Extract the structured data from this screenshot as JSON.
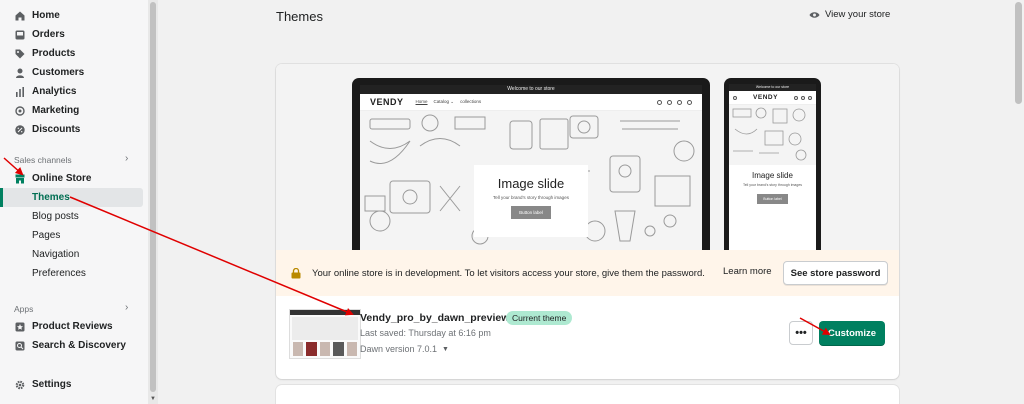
{
  "sidebar": {
    "items": [
      {
        "label": "Home",
        "icon": "home-icon"
      },
      {
        "label": "Orders",
        "icon": "orders-icon"
      },
      {
        "label": "Products",
        "icon": "tag-icon"
      },
      {
        "label": "Customers",
        "icon": "person-icon"
      },
      {
        "label": "Analytics",
        "icon": "bar-chart-icon"
      },
      {
        "label": "Marketing",
        "icon": "target-icon"
      },
      {
        "label": "Discounts",
        "icon": "discount-icon"
      }
    ],
    "sales_channels_label": "Sales channels",
    "online_store": {
      "label": "Online Store",
      "icon": "store-icon"
    },
    "online_store_subitems": [
      "Themes",
      "Blog posts",
      "Pages",
      "Navigation",
      "Preferences"
    ],
    "active_subitem": "Themes",
    "apps_label": "Apps",
    "apps": [
      {
        "label": "Product Reviews",
        "icon": "app-icon"
      },
      {
        "label": "Search & Discovery",
        "icon": "search-app-icon"
      }
    ],
    "settings": {
      "label": "Settings",
      "icon": "gear-icon"
    }
  },
  "header": {
    "title": "Themes",
    "view_store": "View your store"
  },
  "preview": {
    "announcement": "Welcome to our store",
    "logo": "VENDY",
    "menu": [
      "Home",
      "Catalog ⌄",
      "collections"
    ],
    "slide_title": "Image slide",
    "slide_subtitle": "Tell your brand's story through images",
    "slide_button": "Button label"
  },
  "banner": {
    "message": "Your online store is in development. To let visitors access your store, give them the password.",
    "learn_more": "Learn more",
    "password_button": "See store password"
  },
  "theme": {
    "name": "Vendy_pro_by_dawn_preview",
    "badge": "Current theme",
    "last_saved": "Last saved: Thursday at 6:16 pm",
    "version": "Dawn version 7.0.1",
    "more_button": "•••",
    "customize_button": "Customize"
  },
  "colors": {
    "accent": "#008060",
    "badge_bg": "#aee9d1",
    "banner_bg": "#fff5ea",
    "annotation_arrow": "#e00000"
  }
}
